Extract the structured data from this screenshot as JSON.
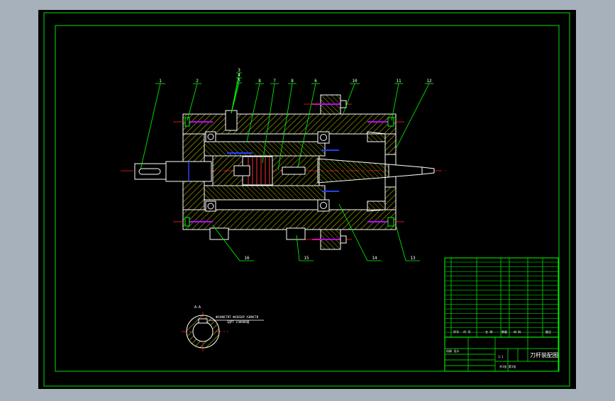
{
  "colors": {
    "window_bg": "#a7b1bc",
    "sheet_bg": "#000000",
    "frame": "#00e000",
    "part_line": "#ffffff",
    "hatch": "#b0b000",
    "leader": "#00ff00",
    "center_line": "#ff2020",
    "bolt": "#c000ff",
    "accent_blue": "#2040ff",
    "table_line": "#00ff00",
    "table_text": "#ffffff"
  },
  "balloons": {
    "top": [
      "1",
      "2",
      "3",
      "4",
      "5",
      "8",
      "7",
      "8",
      "6",
      "10",
      "11",
      "12"
    ],
    "bottom": [
      "16",
      "15",
      "14",
      "13"
    ]
  },
  "section_view": {
    "top_label": "A-A",
    "note_line1": "ФАЗИНСТИТ ФАЗИЗАР АЗИНСТИ",
    "note_line2": "ЗДРТ 11НКНКОД"
  },
  "title_block": {
    "drawing_title": "刀杆装配图",
    "scale_label": "1:1",
    "sheet_label": "共1张 第1张",
    "company": "机械 设计",
    "header_cells": [
      "序号",
      "代 号",
      "名 称",
      "数量",
      "材 料",
      "备注"
    ]
  },
  "icons": {
    "balloon_leader": "leader-line",
    "section_circle": "section-circle-icon"
  }
}
